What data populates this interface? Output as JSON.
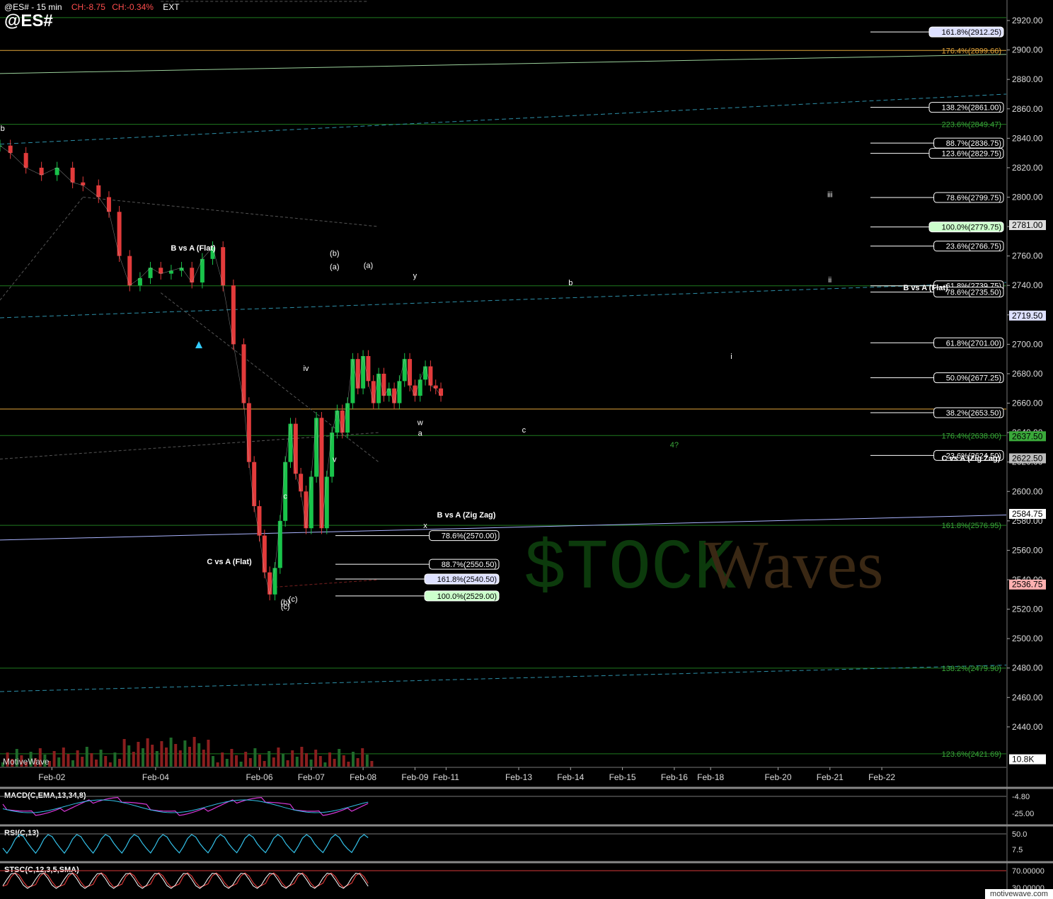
{
  "header": {
    "ticker": "@ES# - 15 min",
    "change_points": "CH:-8.75",
    "change_pct": "CH:-0.34%",
    "session": "EXT",
    "symbol": "@ES#"
  },
  "watermark": {
    "platform": "MotiveWave",
    "brand_left": "$TOCK",
    "brand_right": "Waves",
    "footer_site": "motivewave.com"
  },
  "colors": {
    "bg": "#000000",
    "up": "#19c34a",
    "down": "#e23b3b",
    "grid": "#1f7a1f",
    "fib_orange": "#e3a53a",
    "trend_teal": "#2d8fa8",
    "label_blue": "#aab4ff"
  },
  "chart_data": [
    {
      "type": "line",
      "title": "@ES# - 15 min",
      "ylabel": "",
      "ylim": [
        2413,
        2933
      ],
      "x_ticks": [
        {
          "label": "Feb-02",
          "x": 1
        },
        {
          "label": "Feb-04",
          "x": 3
        },
        {
          "label": "Feb-06",
          "x": 5
        },
        {
          "label": "Feb-07",
          "x": 6
        },
        {
          "label": "Feb-08",
          "x": 7
        },
        {
          "label": "Feb-09",
          "x": 8
        },
        {
          "label": "Feb-11",
          "x": 8.6
        },
        {
          "label": "Feb-13",
          "x": 10
        },
        {
          "label": "Feb-14",
          "x": 11
        },
        {
          "label": "Feb-15",
          "x": 12
        },
        {
          "label": "Feb-16",
          "x": 13
        },
        {
          "label": "Feb-18",
          "x": 13.7
        },
        {
          "label": "Feb-20",
          "x": 15
        },
        {
          "label": "Feb-21",
          "x": 16
        },
        {
          "label": "Feb-22",
          "x": 17
        }
      ],
      "xlim": [
        0,
        19.4
      ],
      "y_ticks": [
        2440,
        2460,
        2480,
        2500,
        2520,
        2540,
        2560,
        2580,
        2600,
        2620,
        2640,
        2660,
        2680,
        2700,
        2720,
        2740,
        2760,
        2780,
        2800,
        2820,
        2840,
        2860,
        2880,
        2900,
        2920
      ],
      "series": [
        {
          "x": [
            0,
            0.2,
            0.5,
            0.8,
            1.1,
            1.4,
            1.6,
            1.9,
            2.1,
            2.3,
            2.5,
            2.7,
            2.9,
            3.1,
            3.3,
            3.5,
            3.7,
            3.9,
            4.1,
            4.3,
            4.5,
            4.7,
            4.8,
            4.9,
            5.0,
            5.1,
            5.2,
            5.3,
            5.4,
            5.5,
            5.6,
            5.7,
            5.8,
            5.9,
            6.0,
            6.1,
            6.2,
            6.3,
            6.4,
            6.5,
            6.6,
            6.7,
            6.8,
            6.9,
            7.0,
            7.1,
            7.2,
            7.3,
            7.4,
            7.5,
            7.6,
            7.7,
            7.8,
            7.9,
            8.0,
            8.1,
            8.2,
            8.3,
            8.4,
            8.5
          ],
          "values": [
            2835,
            2830,
            2820,
            2815,
            2820,
            2810,
            2808,
            2800,
            2790,
            2760,
            2740,
            2745,
            2752,
            2748,
            2750,
            2752,
            2742,
            2758,
            2766,
            2740,
            2700,
            2660,
            2620,
            2590,
            2570,
            2545,
            2530,
            2548,
            2580,
            2620,
            2646,
            2612,
            2600,
            2575,
            2610,
            2650,
            2575,
            2610,
            2640,
            2655,
            2640,
            2660,
            2690,
            2670,
            2692,
            2675,
            2660,
            2680,
            2665,
            2670,
            2660,
            2675,
            2690,
            2672,
            2665,
            2676,
            2685,
            2672,
            2670,
            2665
          ],
          "name": ""
        }
      ],
      "fib_levels": [
        {
          "label": "161.8%(2912.25)",
          "price": 2912.25
        },
        {
          "label": "176.4%(2899.66)",
          "price": 2899.66
        },
        {
          "label": "138.2%(2861.00)",
          "price": 2861.0
        },
        {
          "label": "223.6%(2849.47)",
          "price": 2849.47
        },
        {
          "label": "88.7%(2836.75)",
          "price": 2836.75
        },
        {
          "label": "123.6%(2829.75)",
          "price": 2829.75
        },
        {
          "label": "78.6%(2799.75)",
          "price": 2799.75
        },
        {
          "label": "100.0%(2779.75)",
          "price": 2779.75
        },
        {
          "label": "23.6%(2766.75)",
          "price": 2766.75
        },
        {
          "label": "61.8%(2739.75)",
          "price": 2739.75
        },
        {
          "label": "78.6%(2735.50)",
          "price": 2735.5
        },
        {
          "label": "61.8%(2701.00)",
          "price": 2701.0
        },
        {
          "label": "50.0%(2677.25)",
          "price": 2677.25
        },
        {
          "label": "38.2%(2653.50)",
          "price": 2653.5
        },
        {
          "label": "176.4%(2638.00)",
          "price": 2638.0
        },
        {
          "label": "23.6%(2624.50)",
          "price": 2624.5
        },
        {
          "label": "161.8%(2576.95)",
          "price": 2576.95
        },
        {
          "label": "78.6%(2570.00)",
          "price": 2570.0
        },
        {
          "label": "88.7%(2550.50)",
          "price": 2550.5
        },
        {
          "label": "161.8%(2540.50)",
          "price": 2540.5
        },
        {
          "label": "100.0%(2529.00)",
          "price": 2529.0
        },
        {
          "label": "138.2%(2479.90)",
          "price": 2479.9
        },
        {
          "label": "123.6%(2421.69)",
          "price": 2421.69
        }
      ],
      "price_tags": [
        {
          "label": "2781.00",
          "price": 2781.0
        },
        {
          "label": "2719.50",
          "price": 2719.5
        },
        {
          "label": "2637.50",
          "price": 2637.5
        },
        {
          "label": "2622.50",
          "price": 2622.5
        },
        {
          "label": "2584.75",
          "price": 2584.75
        },
        {
          "label": "2536.75",
          "price": 2536.75
        },
        {
          "label": "10.8K",
          "price": 2418.0
        }
      ],
      "annotations": [
        {
          "text": "B vs A (Flat)"
        },
        {
          "text": "C vs A (Flat)"
        },
        {
          "text": "B vs A (Zig Zag)"
        },
        {
          "text": "C vs A (Zig Zag)"
        },
        {
          "text": "B vs A (Flat)"
        },
        {
          "text": "(b)"
        },
        {
          "text": "(a)"
        },
        {
          "text": "(c)"
        },
        {
          "text": "(b)"
        },
        {
          "text": "(a)"
        },
        {
          "text": "y"
        },
        {
          "text": "w"
        },
        {
          "text": "x"
        },
        {
          "text": "a"
        },
        {
          "text": "b"
        },
        {
          "text": "c"
        },
        {
          "text": "c"
        },
        {
          "text": "b"
        },
        {
          "text": "4?"
        },
        {
          "text": "i"
        },
        {
          "text": "ii"
        },
        {
          "text": "iii"
        },
        {
          "text": "iv"
        },
        {
          "text": "v"
        },
        {
          "text": "(c)"
        }
      ],
      "wave_x": [
        1.0,
        3.05,
        3.0,
        5.0,
        4.9,
        6.45,
        6.45,
        5.65,
        5.5,
        7.1,
        7.2,
        8.1,
        8.2,
        8.1,
        0.05,
        5.5,
        10.1,
        11.0,
        13.0,
        14.1,
        16.0,
        16.0,
        5.9,
        6.45,
        5.5,
        8.2,
        16.0
      ],
      "legend": "none",
      "grid": true
    },
    {
      "type": "line",
      "title": "MACD(C,EMA,13,34,8)",
      "ylim": [
        -30,
        15
      ],
      "y_tick_labels": [
        "-4.80",
        "-25.00"
      ]
    },
    {
      "type": "line",
      "title": "RSI(C,13)",
      "ylim": [
        0,
        100
      ],
      "y_tick_labels": [
        "50.0",
        "7.5"
      ]
    },
    {
      "type": "line",
      "title": "STSC(C,12,3,5,SMA)",
      "ylim": [
        0,
        100
      ],
      "y_tick_labels": [
        "70.00000",
        "30.00000"
      ]
    }
  ]
}
